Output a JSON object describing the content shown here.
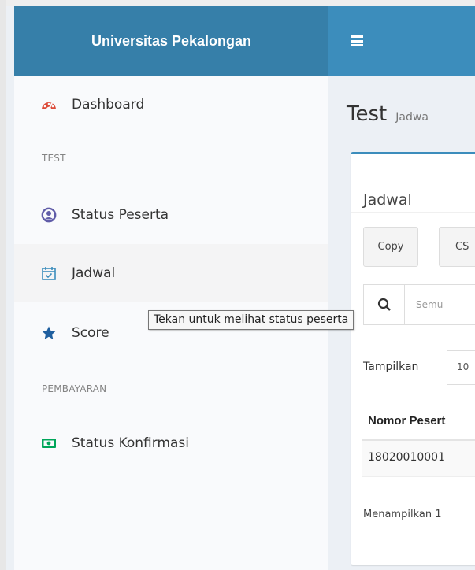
{
  "header": {
    "logo": "Universitas Pekalongan"
  },
  "sidebar": {
    "items": [
      {
        "label": "Dashboard",
        "icon": "dashboard-icon"
      },
      {
        "label": "Status Peserta",
        "icon": "user-circle-icon"
      },
      {
        "label": "Jadwal",
        "icon": "calendar-check-icon"
      },
      {
        "label": "Score",
        "icon": "star-icon"
      },
      {
        "label": "Status Konfirmasi",
        "icon": "money-icon"
      }
    ],
    "headers": [
      "TEST",
      "PEMBAYARAN"
    ]
  },
  "tooltip": "Tekan untuk melihat status peserta",
  "content": {
    "title": "Test",
    "subtitle": "Jadwa",
    "box": {
      "title": "Jadwal",
      "buttons": [
        "Copy",
        "CS"
      ],
      "search_placeholder": "Semu",
      "show_label": "Tampilkan",
      "show_value": "10",
      "table": {
        "header": "Nomor Pesert",
        "row": "18020010001"
      },
      "info": "Menampilkan 1"
    }
  },
  "colors": {
    "header_logo_bg": "#367fa9",
    "header_nav_bg": "#3c8dbc",
    "dashboard_icon": "#dd4b39",
    "user_icon": "#605ca8",
    "calendar_icon": "#3c8dbc",
    "star_icon": "#1f5f9f",
    "money_icon": "#00a65a"
  }
}
